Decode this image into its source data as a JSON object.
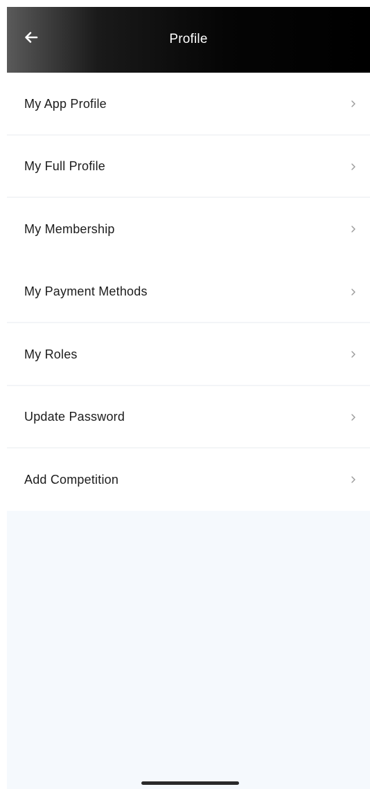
{
  "header": {
    "title": "Profile",
    "back_icon": "arrow-left-icon"
  },
  "menu": {
    "items": [
      {
        "label": "My App Profile",
        "icon": "chevron-right-icon"
      },
      {
        "label": "My Full Profile",
        "icon": "chevron-right-icon"
      },
      {
        "label": "My Membership",
        "icon": "chevron-right-icon"
      },
      {
        "label": "My Payment Methods",
        "icon": "chevron-right-icon"
      },
      {
        "label": "My Roles",
        "icon": "chevron-right-icon"
      },
      {
        "label": "Update Password",
        "icon": "chevron-right-icon"
      },
      {
        "label": "Add Competition",
        "icon": "chevron-right-icon"
      }
    ]
  },
  "colors": {
    "header_bg": "#000000",
    "header_text": "#ffffff",
    "row_bg": "#ffffff",
    "separator": "#f3f5f7",
    "empty_area_bg": "#f5f9fd",
    "label_text": "#1c1c1c",
    "chevron": "#9a9a9a"
  }
}
